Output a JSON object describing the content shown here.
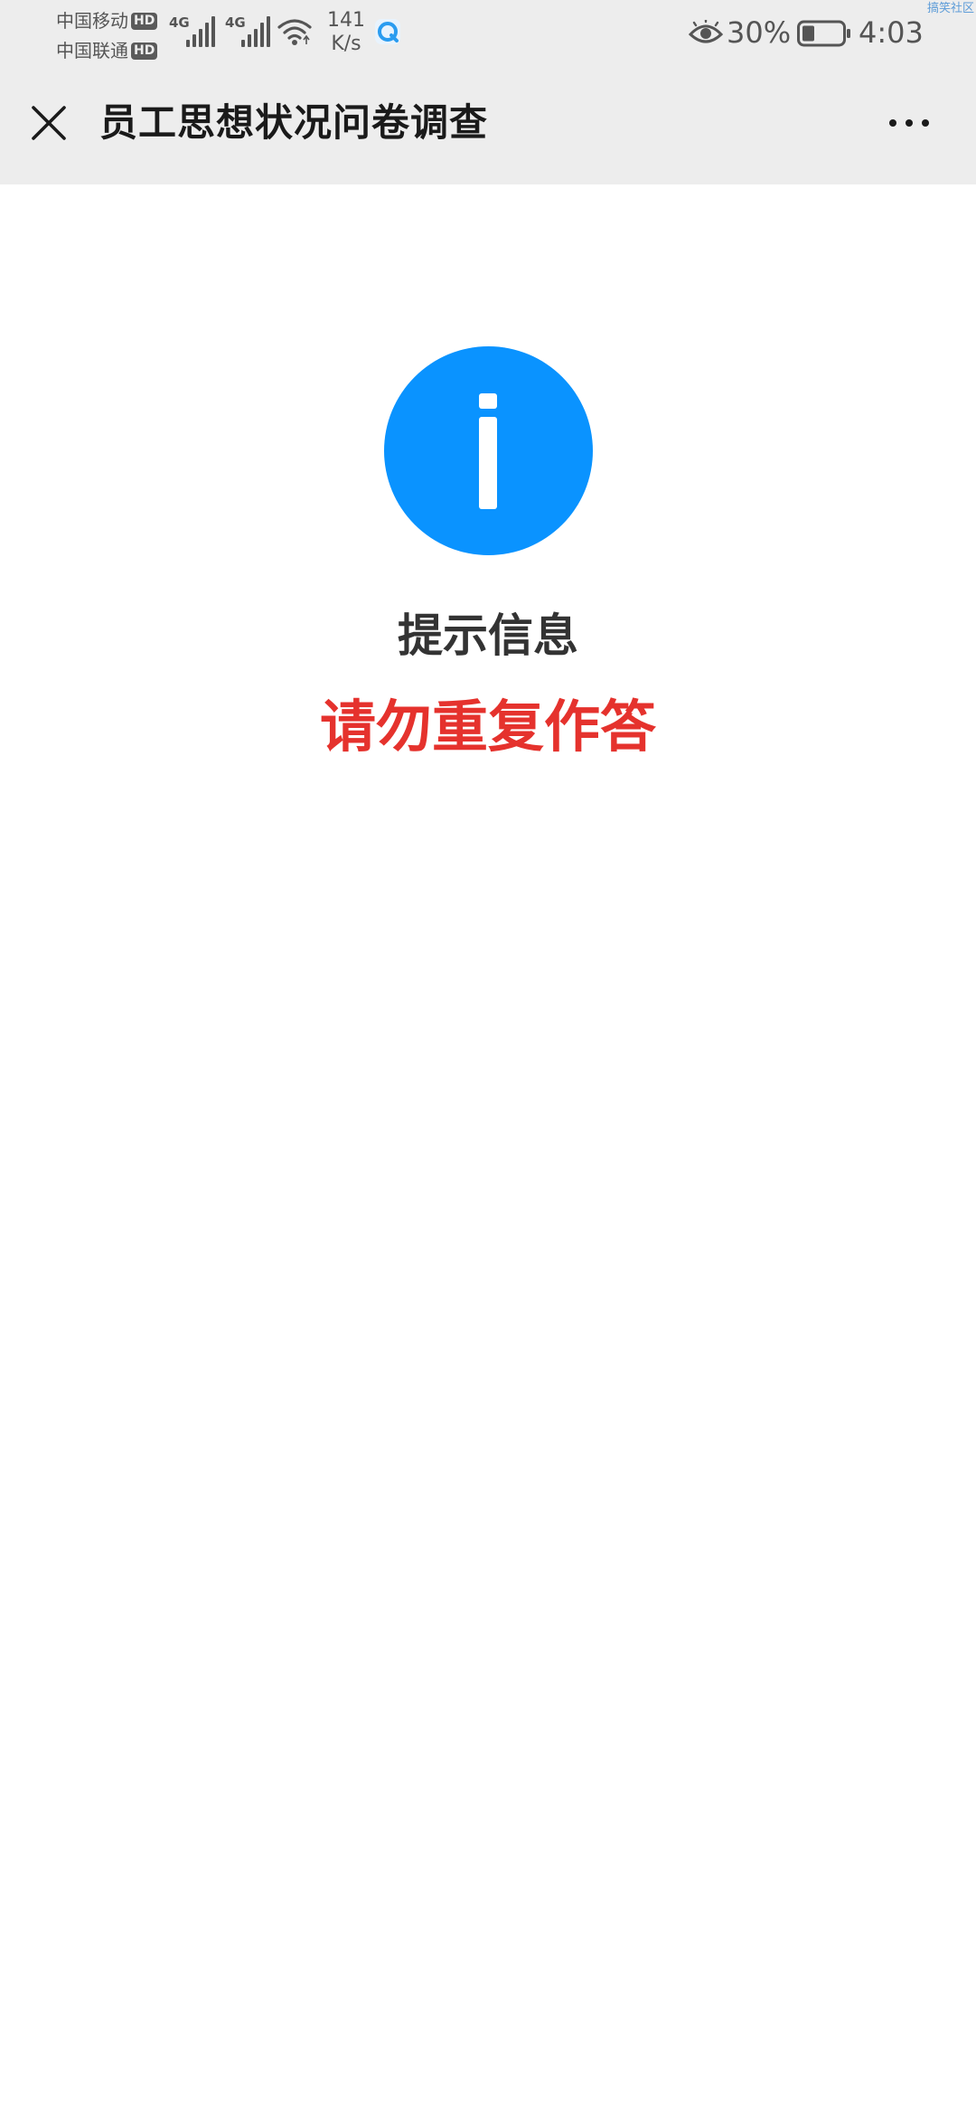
{
  "status_bar": {
    "carriers": [
      {
        "name": "中国移动",
        "badge": "HD"
      },
      {
        "name": "中国联通",
        "badge": "HD"
      }
    ],
    "network": [
      "4G",
      "4G"
    ],
    "speed_value": "141",
    "speed_unit": "K/s",
    "battery_percent": "30%",
    "battery_level": 0.3,
    "time": "4:03",
    "corner_watermark": "搞笑社区"
  },
  "header": {
    "title": "员工思想状况问卷调查"
  },
  "message": {
    "title": "提示信息",
    "body": "请勿重复作答"
  },
  "colors": {
    "info_icon": "#0a93ff",
    "warning_text": "#e5322d",
    "chrome_background": "#ededed",
    "page_background": "#ffffff"
  },
  "icons": {
    "close": "close-icon",
    "more": "more-icon",
    "info": "info-icon"
  }
}
